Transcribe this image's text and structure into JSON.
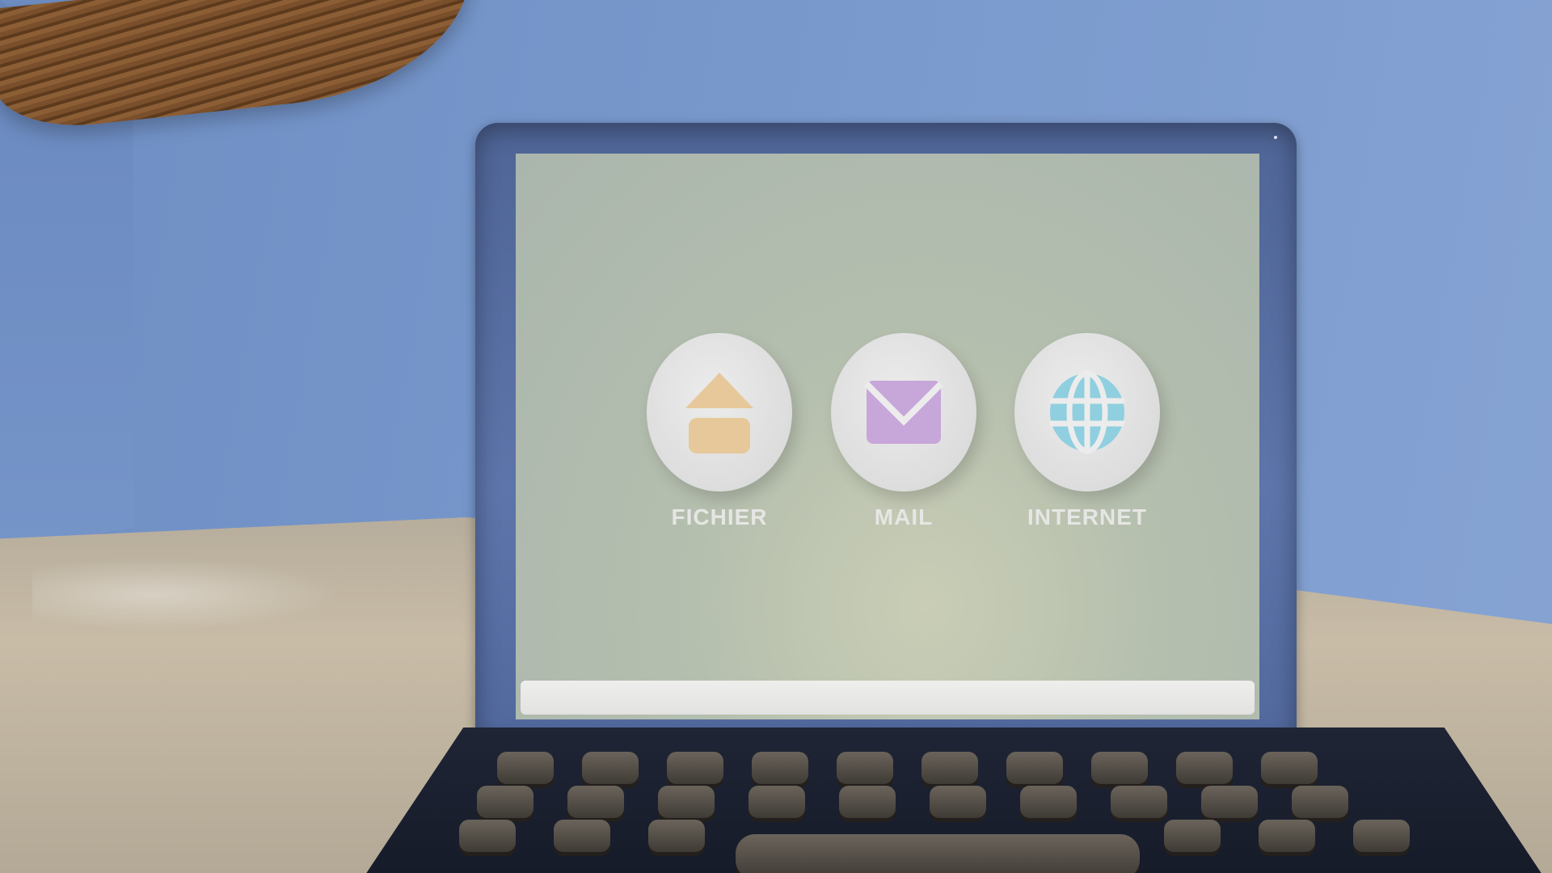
{
  "desktop": {
    "apps": [
      {
        "label": "FICHIER",
        "icon": "home-icon",
        "icon_color": "#e7c89a"
      },
      {
        "label": "MAIL",
        "icon": "envelope-icon",
        "icon_color": "#c7a6d9"
      },
      {
        "label": "INTERNET",
        "icon": "globe-icon",
        "icon_color": "#8fcfe0"
      }
    ]
  }
}
